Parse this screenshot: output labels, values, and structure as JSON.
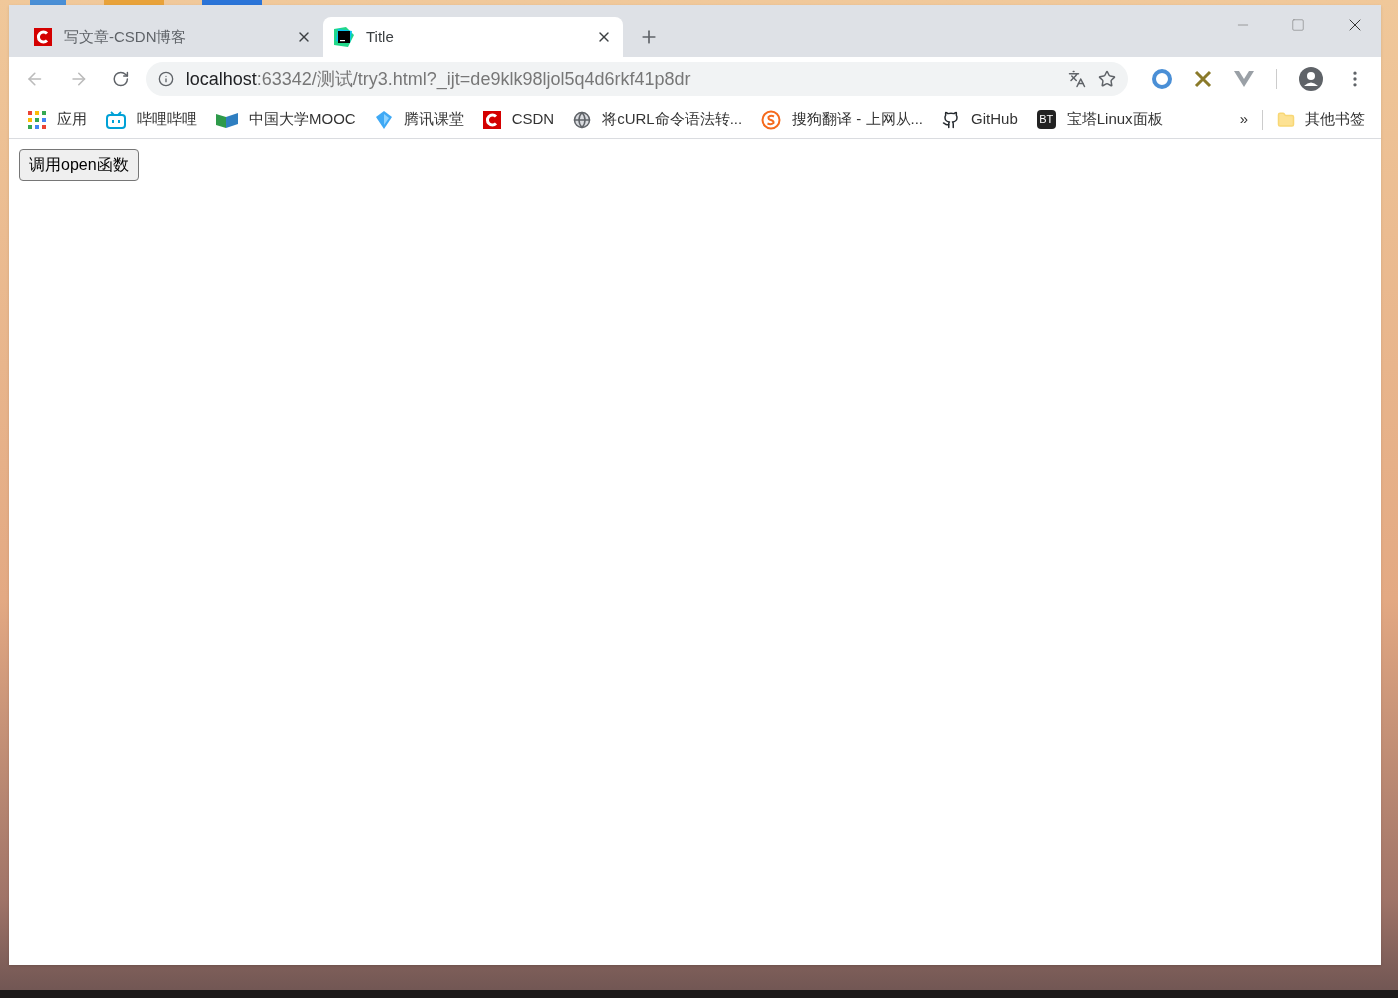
{
  "tabs": [
    {
      "title": "写文章-CSDN博客",
      "kind": "csdn",
      "selected": false
    },
    {
      "title": "Title",
      "kind": "ws",
      "selected": true
    }
  ],
  "address": {
    "host": "localhost",
    "rest": ":63342/测试/try3.html?_ijt=de9klk98ljol5q4d6rkf41p8dr"
  },
  "bookmarks": [
    {
      "label": "应用",
      "kind": "apps"
    },
    {
      "label": "哔哩哔哩",
      "kind": "tv"
    },
    {
      "label": "中国大学MOOC",
      "kind": "book"
    },
    {
      "label": "腾讯课堂",
      "kind": "diamond"
    },
    {
      "label": "CSDN",
      "kind": "csdn"
    },
    {
      "label": "将cURL命令语法转...",
      "kind": "globe"
    },
    {
      "label": "搜狗翻译 - 上网从...",
      "kind": "sogou"
    },
    {
      "label": "GitHub",
      "kind": "github"
    },
    {
      "label": "宝塔Linux面板",
      "kind": "badge",
      "badge": "BT"
    }
  ],
  "bookmarks_overflow": "»",
  "other_bookmarks": "其他书签",
  "page": {
    "button": "调用open函数"
  }
}
